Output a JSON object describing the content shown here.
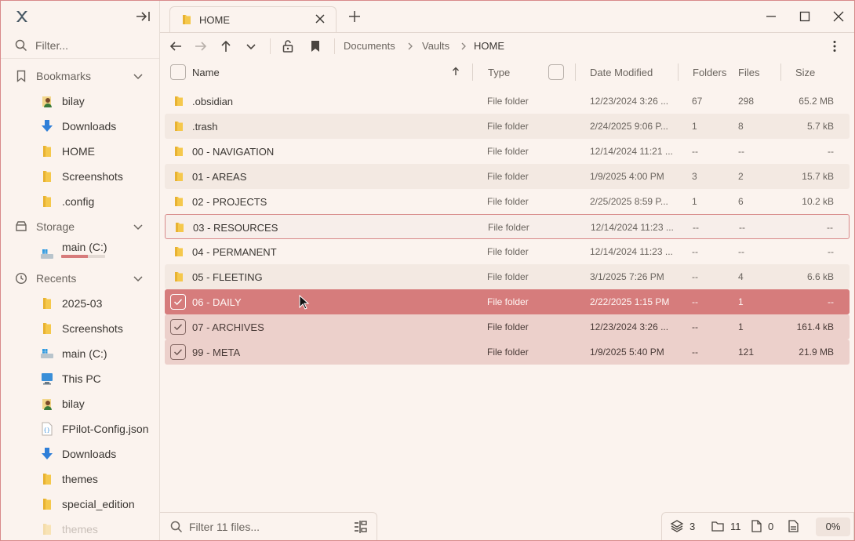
{
  "sidebar": {
    "filter_placeholder": "Filter...",
    "sections": {
      "bookmarks": "Bookmarks",
      "storage": "Storage",
      "recents": "Recents"
    },
    "bookmarks": [
      {
        "label": "bilay",
        "icon": "user-folder-icon"
      },
      {
        "label": "Downloads",
        "icon": "download-arrow-icon"
      },
      {
        "label": "HOME",
        "icon": "folder-icon"
      },
      {
        "label": "Screenshots",
        "icon": "folder-icon"
      },
      {
        "label": ".config",
        "icon": "folder-icon"
      }
    ],
    "storage": [
      {
        "label": "main (C:)",
        "icon": "drive-icon",
        "used_fraction": 0.6
      }
    ],
    "recents": [
      {
        "label": "2025-03",
        "icon": "folder-icon"
      },
      {
        "label": "Screenshots",
        "icon": "folder-icon"
      },
      {
        "label": "main (C:)",
        "icon": "drive-icon"
      },
      {
        "label": "This PC",
        "icon": "computer-icon"
      },
      {
        "label": "bilay",
        "icon": "user-folder-icon"
      },
      {
        "label": "FPilot-Config.json",
        "icon": "json-file-icon"
      },
      {
        "label": "Downloads",
        "icon": "download-arrow-icon"
      },
      {
        "label": "themes",
        "icon": "folder-icon"
      },
      {
        "label": "special_edition",
        "icon": "folder-icon"
      },
      {
        "label": "themes",
        "icon": "folder-icon"
      }
    ]
  },
  "tab": {
    "label": "HOME"
  },
  "breadcrumb": [
    "Documents",
    "Vaults",
    "HOME"
  ],
  "columns": {
    "name": "Name",
    "type": "Type",
    "date": "Date Modified",
    "folders": "Folders",
    "files": "Files",
    "size": "Size"
  },
  "rows": [
    {
      "name": ".obsidian",
      "type": "File folder",
      "date": "12/23/2024 3:26 ...",
      "folders": "67",
      "files": "298",
      "size": "65.2 MB",
      "state": "normal"
    },
    {
      "name": ".trash",
      "type": "File folder",
      "date": "2/24/2025 9:06 P...",
      "folders": "1",
      "files": "8",
      "size": "5.7 kB",
      "state": "alt"
    },
    {
      "name": "00 - NAVIGATION",
      "type": "File folder",
      "date": "12/14/2024 11:21 ...",
      "folders": "--",
      "files": "--",
      "size": "--",
      "state": "normal"
    },
    {
      "name": "01 - AREAS",
      "type": "File folder",
      "date": "1/9/2025 4:00 PM",
      "folders": "3",
      "files": "2",
      "size": "15.7 kB",
      "state": "alt"
    },
    {
      "name": "02 - PROJECTS",
      "type": "File folder",
      "date": "2/25/2025 8:59 P...",
      "folders": "1",
      "files": "6",
      "size": "10.2 kB",
      "state": "normal"
    },
    {
      "name": "03 - RESOURCES",
      "type": "File folder",
      "date": "12/14/2024 11:23 ...",
      "folders": "--",
      "files": "--",
      "size": "--",
      "state": "hover"
    },
    {
      "name": "04 - PERMANENT",
      "type": "File folder",
      "date": "12/14/2024 11:23 ...",
      "folders": "--",
      "files": "--",
      "size": "--",
      "state": "normal"
    },
    {
      "name": "05 - FLEETING",
      "type": "File folder",
      "date": "3/1/2025 7:26 PM",
      "folders": "--",
      "files": "4",
      "size": "6.6 kB",
      "state": "alt"
    },
    {
      "name": "06 - DAILY",
      "type": "File folder",
      "date": "2/22/2025 1:15 PM",
      "folders": "--",
      "files": "1",
      "size": "--",
      "state": "sel-active"
    },
    {
      "name": "07 - ARCHIVES",
      "type": "File folder",
      "date": "12/23/2024 3:26 ...",
      "folders": "--",
      "files": "1",
      "size": "161.4 kB",
      "state": "sel"
    },
    {
      "name": "99 - META",
      "type": "File folder",
      "date": "1/9/2025 5:40 PM",
      "folders": "--",
      "files": "121",
      "size": "21.9 MB",
      "state": "sel"
    }
  ],
  "statusbar": {
    "filter_placeholder": "Filter 11 files...",
    "selected_count": "3",
    "folder_count": "11",
    "file_count": "0",
    "percent": "0%"
  },
  "colors": {
    "accent": "#d67c7c",
    "selection_light": "#ecd0cb",
    "background": "#fbf3ee",
    "folder_yellow": "#f5c84c"
  }
}
